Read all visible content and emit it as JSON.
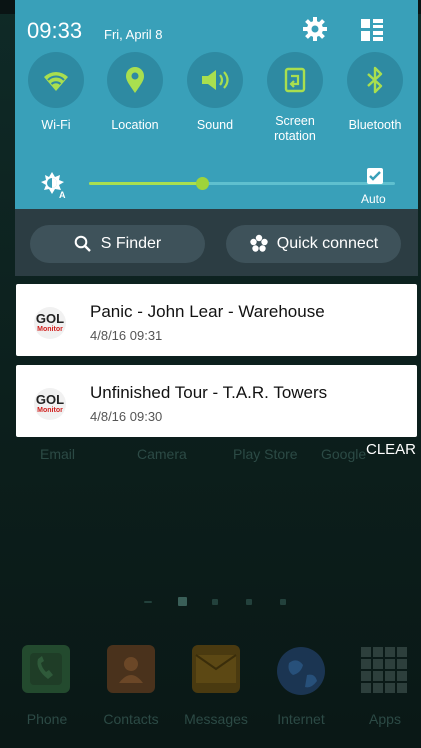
{
  "status": {
    "time": "09:33",
    "date": "Fri, April 8"
  },
  "toggles": [
    {
      "label": "Wi-Fi",
      "icon": "wifi-icon"
    },
    {
      "label": "Location",
      "icon": "location-pin-icon"
    },
    {
      "label": "Sound",
      "icon": "speaker-icon"
    },
    {
      "label_line1": "Screen",
      "label_line2": "rotation",
      "icon": "screen-rotation-icon"
    },
    {
      "label": "Bluetooth",
      "icon": "bluetooth-icon"
    }
  ],
  "brightness": {
    "level": 0.37,
    "auto_label": "Auto",
    "auto_checked": true
  },
  "actions": {
    "finder": "S Finder",
    "quick_connect": "Quick connect"
  },
  "notifications": [
    {
      "app": "GOL Monitor",
      "logo_top": "GOL",
      "logo_bottom": "Monitor",
      "title": "Panic - John Lear - Warehouse",
      "time": "4/8/16 09:31"
    },
    {
      "app": "GOL Monitor",
      "logo_top": "GOL",
      "logo_bottom": "Monitor",
      "title": "Unfinished Tour - T.A.R. Towers",
      "time": "4/8/16 09:30"
    }
  ],
  "clear_label": "CLEAR",
  "home": {
    "app_row": [
      "Email",
      "Camera",
      "Play Store",
      "Google"
    ],
    "dock": [
      "Phone",
      "Contacts",
      "Messages",
      "Internet",
      "Apps"
    ]
  },
  "colors": {
    "panel": "#39a0b9",
    "accent_green": "#a9df4f",
    "notification_bg": "#ffffff"
  }
}
